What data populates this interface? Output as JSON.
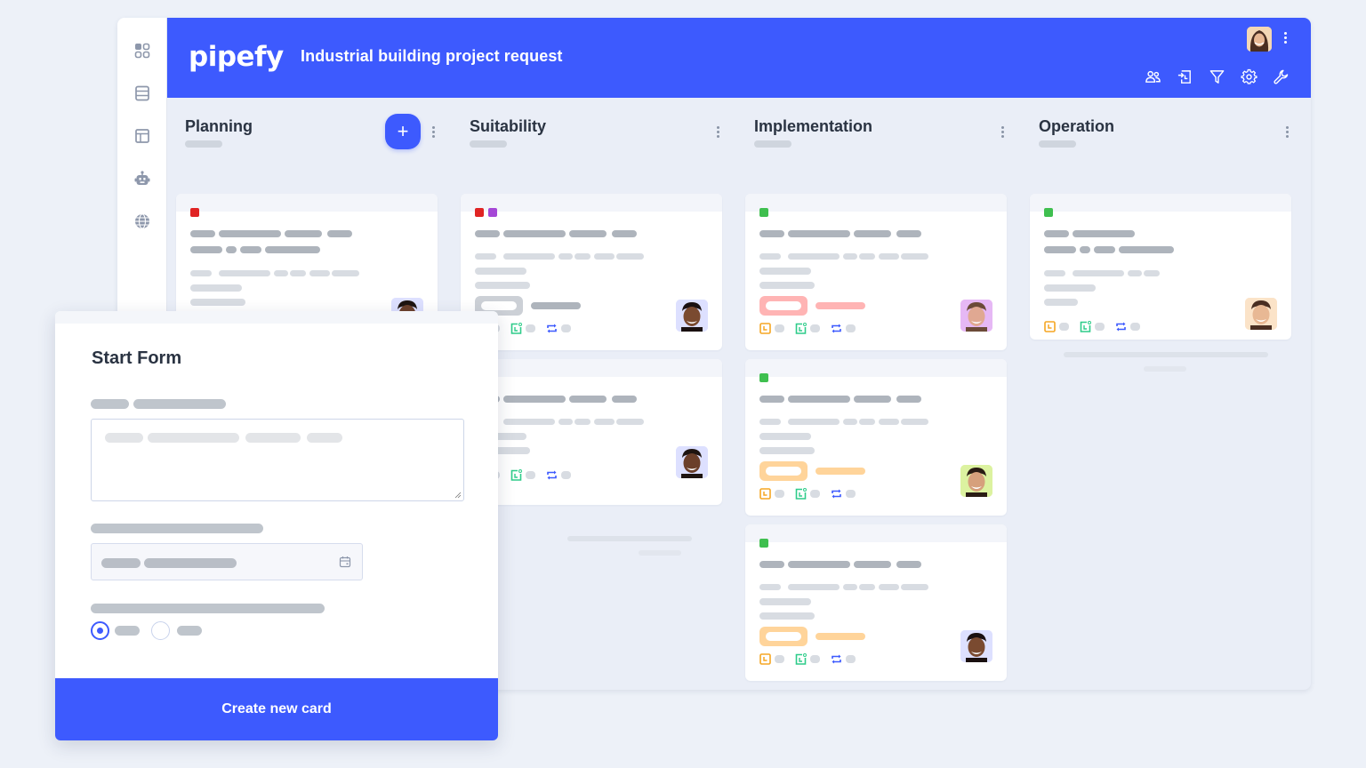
{
  "header": {
    "logo": "pipefy",
    "board_title": "Industrial building project request",
    "user_avatar": "user-avatar-woman",
    "tools": [
      "members-icon",
      "import-icon",
      "filter-icon",
      "settings-icon",
      "wrench-icon"
    ]
  },
  "sidebar": {
    "items": [
      "apps-grid-icon",
      "database-icon",
      "layout-icon",
      "bot-icon",
      "globe-icon"
    ]
  },
  "colors": {
    "brand": "#3d5afe",
    "label_red": "#e02424",
    "label_purple": "#a547d6",
    "label_green": "#3fbf4f",
    "tag_gray": "#ccd0d6",
    "tag_red": "#ffb4b4",
    "tag_orange": "#ffd49a",
    "meta_clock": "#f5a623",
    "meta_calendar": "#2ecc8a",
    "meta_repeat": "#3d5afe"
  },
  "phases": [
    {
      "title": "Planning",
      "add_button": "+",
      "cards": [
        {
          "labels": [
            "red"
          ],
          "tag": null,
          "assignee": "avatar-woman-glasses"
        }
      ]
    },
    {
      "title": "Suitability",
      "cards": [
        {
          "labels": [
            "red",
            "purple"
          ],
          "tag": "gray",
          "assignee": "avatar-man-beard"
        },
        {
          "labels": [],
          "tag": null,
          "assignee": "avatar-woman-glasses"
        }
      ]
    },
    {
      "title": "Implementation",
      "cards": [
        {
          "labels": [
            "green"
          ],
          "tag": "red",
          "assignee": "avatar-man-smile"
        },
        {
          "labels": [
            "green"
          ],
          "tag": "orange",
          "assignee": "avatar-man-dark-hair"
        },
        {
          "labels": [
            "green"
          ],
          "tag": "orange",
          "assignee": "avatar-man-beard"
        }
      ]
    },
    {
      "title": "Operation",
      "cards": [
        {
          "labels": [
            "green"
          ],
          "tag": null,
          "assignee": "avatar-woman-smile"
        }
      ]
    }
  ],
  "start_form": {
    "title": "Start Form",
    "radio_selected_index": 0,
    "submit_label": "Create new card"
  }
}
